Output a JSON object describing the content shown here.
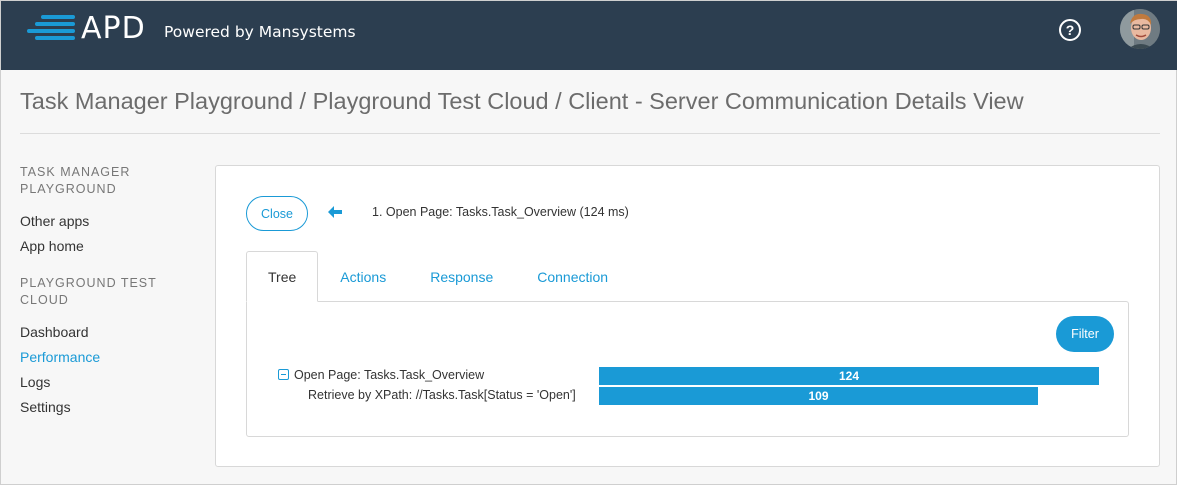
{
  "header": {
    "logo_text": "APD",
    "subtitle": "Powered by Mansystems",
    "help_glyph": "?",
    "brand_color": "#2c3e50"
  },
  "page_title": "Task Manager Playground / Playground Test Cloud / Client - Server Communication Details View",
  "sidebar": {
    "sections": [
      {
        "title": "TASK MANAGER PLAYGROUND",
        "items": [
          {
            "label": "Other apps"
          },
          {
            "label": "App home"
          }
        ]
      },
      {
        "title": "PLAYGROUND TEST CLOUD",
        "items": [
          {
            "label": "Dashboard"
          },
          {
            "label": "Performance",
            "active": true
          },
          {
            "label": "Logs"
          },
          {
            "label": "Settings"
          }
        ]
      }
    ]
  },
  "details": {
    "close_label": "Close",
    "back_icon": "arrow-left-icon",
    "step_label": "1. Open Page: Tasks.Task_Overview (124 ms)",
    "tabs": [
      {
        "label": "Tree",
        "active": true
      },
      {
        "label": "Actions"
      },
      {
        "label": "Response"
      },
      {
        "label": "Connection"
      }
    ],
    "filter_label": "Filter",
    "tree": [
      {
        "label": "Open Page: Tasks.Task_Overview",
        "value": "124",
        "collapsible": true
      },
      {
        "label": "Retrieve by XPath: //Tasks.Task[Status = 'Open']",
        "value": "109",
        "collapsible": false
      }
    ],
    "accent_color": "#1a9ad6"
  }
}
